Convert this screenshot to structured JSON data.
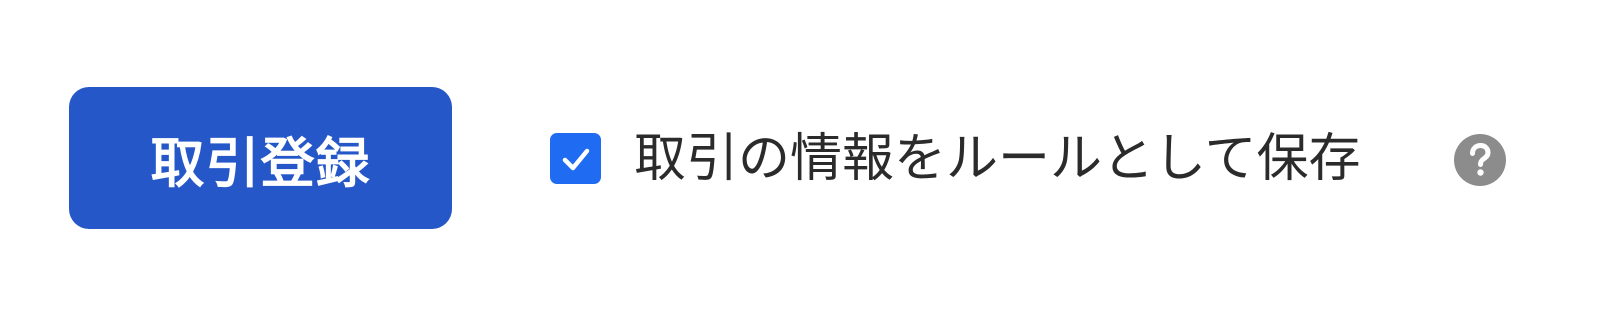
{
  "form": {
    "submit_label": "取引登録",
    "save_rule_checkbox": {
      "checked": true,
      "label": "取引の情報をルールとして保存"
    },
    "help_icon": "question-circle-icon"
  },
  "colors": {
    "button_bg": "#2557c8",
    "checkbox_bg": "#1f6bf2",
    "help_icon_bg": "#8c8c8c",
    "label_text": "#2b2b2b"
  }
}
